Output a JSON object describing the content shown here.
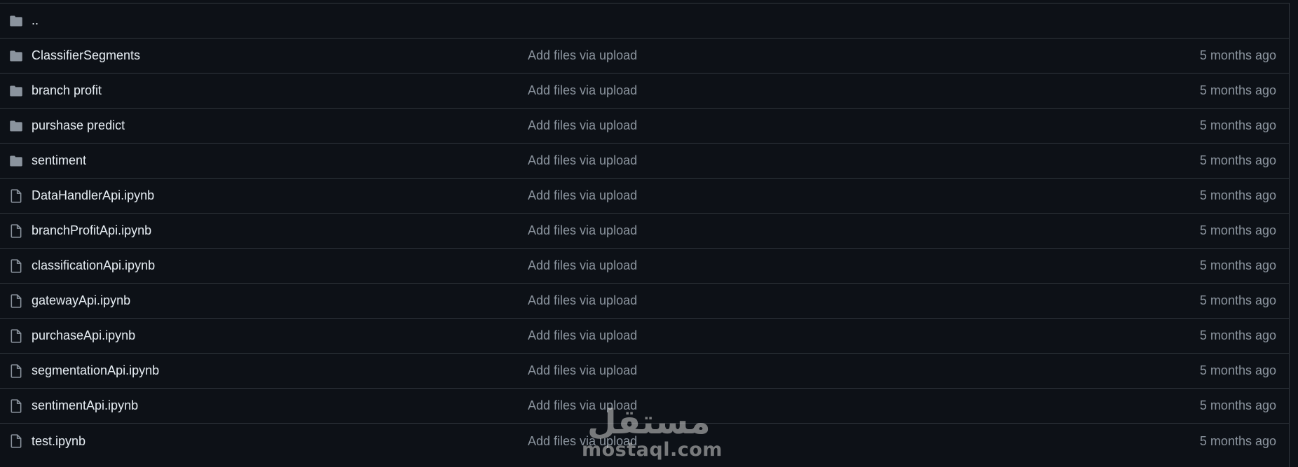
{
  "rows": [
    {
      "type": "folder",
      "icon": "folder-icon",
      "name": "..",
      "commit": "",
      "date": ""
    },
    {
      "type": "folder",
      "icon": "folder-icon",
      "name": "ClassifierSegments",
      "commit": "Add files via upload",
      "date": "5 months ago"
    },
    {
      "type": "folder",
      "icon": "folder-icon",
      "name": "branch profit",
      "commit": "Add files via upload",
      "date": "5 months ago"
    },
    {
      "type": "folder",
      "icon": "folder-icon",
      "name": "purshase predict",
      "commit": "Add files via upload",
      "date": "5 months ago"
    },
    {
      "type": "folder",
      "icon": "folder-icon",
      "name": "sentiment",
      "commit": "Add files via upload",
      "date": "5 months ago"
    },
    {
      "type": "file",
      "icon": "file-icon",
      "name": "DataHandlerApi.ipynb",
      "commit": "Add files via upload",
      "date": "5 months ago"
    },
    {
      "type": "file",
      "icon": "file-icon",
      "name": "branchProfitApi.ipynb",
      "commit": "Add files via upload",
      "date": "5 months ago"
    },
    {
      "type": "file",
      "icon": "file-icon",
      "name": "classificationApi.ipynb",
      "commit": "Add files via upload",
      "date": "5 months ago"
    },
    {
      "type": "file",
      "icon": "file-icon",
      "name": "gatewayApi.ipynb",
      "commit": "Add files via upload",
      "date": "5 months ago"
    },
    {
      "type": "file",
      "icon": "file-icon",
      "name": "purchaseApi.ipynb",
      "commit": "Add files via upload",
      "date": "5 months ago"
    },
    {
      "type": "file",
      "icon": "file-icon",
      "name": "segmentationApi.ipynb",
      "commit": "Add files via upload",
      "date": "5 months ago"
    },
    {
      "type": "file",
      "icon": "file-icon",
      "name": "sentimentApi.ipynb",
      "commit": "Add files via upload",
      "date": "5 months ago"
    },
    {
      "type": "file",
      "icon": "file-icon",
      "name": "test.ipynb",
      "commit": "Add files via upload",
      "date": "5 months ago"
    }
  ],
  "watermark": {
    "arabic": "مستقل",
    "latin": "mostaql.com"
  },
  "colors": {
    "background": "#0d1117",
    "border": "#30363d",
    "name_text": "#e6edf3",
    "muted_text": "#8b949e",
    "icon": "#8b949e"
  }
}
